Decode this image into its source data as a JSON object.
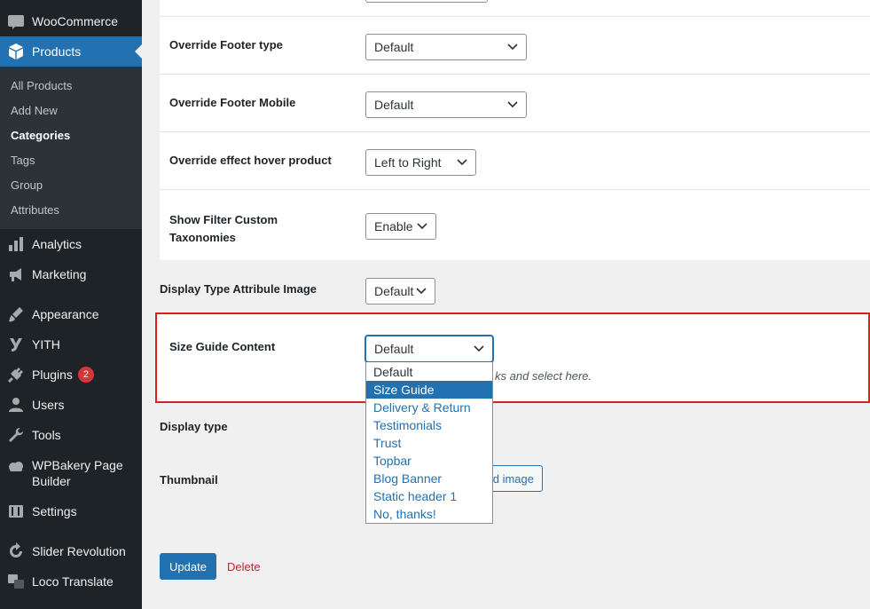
{
  "sidebar": {
    "woocommerce": "WooCommerce",
    "products": "Products",
    "submenu": [
      "All Products",
      "Add New",
      "Categories",
      "Tags",
      "Group",
      "Attributes"
    ],
    "analytics": "Analytics",
    "marketing": "Marketing",
    "appearance": "Appearance",
    "yith": "YITH",
    "plugins": "Plugins",
    "plugins_badge": "2",
    "users": "Users",
    "tools": "Tools",
    "wpbakery_line1": "WPBakery Page",
    "wpbakery_line2": "Builder",
    "settings": "Settings",
    "slider_revolution": "Slider Revolution",
    "loco_translate": "Loco Translate",
    "icon_badge_woo": "woo"
  },
  "form": {
    "override_footer_type": {
      "label": "Override Footer type",
      "value": "Default"
    },
    "override_footer_mobile": {
      "label": "Override Footer Mobile",
      "value": "Default"
    },
    "override_effect_hover": {
      "label": "Override effect hover product",
      "value": "Left to Right"
    },
    "show_filter_line1": "Show Filter Custom",
    "show_filter_line2": "Taxonomies",
    "show_filter_value": "Enable",
    "display_type_attr": {
      "label": "Display Type Attribule Image",
      "value": "Default"
    },
    "size_guide": {
      "label": "Size Guide Content",
      "value": "Default",
      "description": "ks and select here.",
      "options": [
        "Default",
        "Size Guide",
        "Delivery & Return",
        "Testimonials",
        "Trust",
        "Topbar",
        "Blog Banner",
        "Static header 1",
        "No, thanks!"
      ]
    },
    "display_type": {
      "label": "Display type"
    },
    "thumbnail": {
      "label": "Thumbnail",
      "upload_label": "d image"
    }
  },
  "actions": {
    "update": "Update",
    "delete": "Delete"
  },
  "colors": {
    "sidebar_bg": "#1d2327",
    "accent": "#2271b1",
    "highlight_border": "#e01b22",
    "delete": "#b32d2e",
    "badge": "#d63638"
  }
}
